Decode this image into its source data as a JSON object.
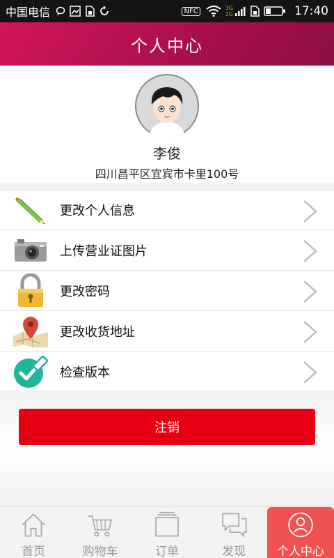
{
  "status_bar": {
    "carrier": "中国电信",
    "nfc": "NFC",
    "net_3g": "3G",
    "net_2g": "2G",
    "time": "17:40"
  },
  "header": {
    "title": "个人中心"
  },
  "profile": {
    "name": "李俊",
    "address": "四川昌平区宜宾市卡里100号"
  },
  "menu": {
    "items": [
      {
        "label": "更改个人信息",
        "icon": "pencil-icon"
      },
      {
        "label": "上传营业证图片",
        "icon": "camera-icon"
      },
      {
        "label": "更改密码",
        "icon": "lock-icon"
      },
      {
        "label": "更改收货地址",
        "icon": "map-pin-icon"
      },
      {
        "label": "检查版本",
        "icon": "check-badge-icon"
      }
    ]
  },
  "logout": {
    "label": "注销"
  },
  "tabbar": {
    "tabs": [
      {
        "label": "首页",
        "icon": "home-icon"
      },
      {
        "label": "购物车",
        "icon": "cart-icon"
      },
      {
        "label": "订单",
        "icon": "orders-icon"
      },
      {
        "label": "发现",
        "icon": "chat-icon"
      },
      {
        "label": "个人中心",
        "icon": "user-icon",
        "active": true
      }
    ]
  },
  "colors": {
    "header": "#b0104f",
    "logout": "#e60012",
    "tab_active": "#f05151"
  }
}
